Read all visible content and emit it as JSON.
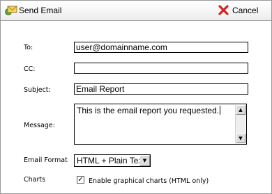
{
  "window": {
    "title": "Send Email",
    "title_icon": "envelope-icon",
    "cancel_label": "Cancel",
    "cancel_icon": "red-x-icon"
  },
  "form": {
    "to_label": "To:",
    "to_value": "user@domainname.com",
    "cc_label": "CC:",
    "cc_value": "",
    "subject_label": "Subject:",
    "subject_value": "Email Report",
    "message_label": "Message:",
    "message_value": "This is the email report you requested.",
    "email_format_label": "Email Format",
    "email_format_value": "HTML + Plain Text",
    "charts_label": "Charts",
    "charts_checkbox_label": "Enable graphical charts (HTML only)",
    "charts_checked": true
  },
  "colors": {
    "cancel_red": "#d32222",
    "envelope_yellow": "#f4d35e",
    "envelope_green": "#5aa83c"
  }
}
